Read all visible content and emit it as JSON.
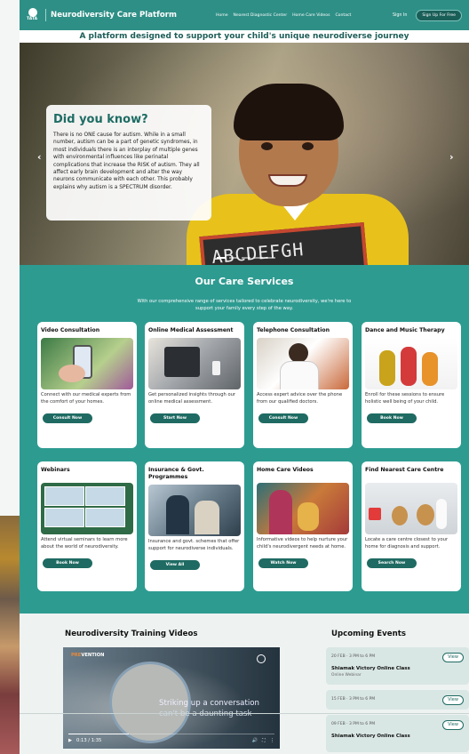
{
  "nav": {
    "logo_small": "TATA",
    "title": "Neurodiversity Care Platform",
    "links": [
      "Home",
      "Nearest Diagnostic Center",
      "Home Care Videos",
      "Contact"
    ],
    "sign_in": "Sign In",
    "sign_up": "Sign Up For Free"
  },
  "tagline": "A platform designed to support your child's unique neurodiverse journey",
  "hero": {
    "card_title": "Did you know?",
    "card_text": "There is no ONE cause for autism. While in a small number, autism can be a part of genetic syndromes, in most individuals there is an interplay of multiple genes with environmental influences like perinatal complications that increase the RISK of autism. They all affect early brain development and alter the way neurons communicate with each other. This probably explains why autism is a SPECTRUM disorder.",
    "slate_text": "ABCDEFGH",
    "prev_arrow": "‹",
    "next_arrow": "›"
  },
  "services": {
    "title": "Our Care Services",
    "intro": "With our comprehensive range of services tailored to celebrate neurodiversity, we're here to support your family every step of the way.",
    "cards": [
      {
        "title": "Video Consultation",
        "text": "Connect with our medical experts from the comfort of your homes.",
        "button": "Consult Now"
      },
      {
        "title": "Online Medical Assessment",
        "text": "Get personalized insights through our online medical assessment.",
        "button": "Start Now"
      },
      {
        "title": "Telephone Consultation",
        "text": "Access expert advice over the phone from our qualified doctors.",
        "button": "Consult Now"
      },
      {
        "title": "Dance and Music Therapy",
        "text": "Enroll for these sessions to ensure holistic well being of your child.",
        "button": "Book Now"
      },
      {
        "title": "Webinars",
        "text": "Attend virtual seminars to learn more about the world of neurodiversity.",
        "button": "Book Now"
      },
      {
        "title": "Insurance & Govt. Programmes",
        "text": "Insurance and govt. schemes that offer support for neurodiverse individuals.",
        "button": "View All"
      },
      {
        "title": "Home Care Videos",
        "text": "Informative videos to help nurture your child's neurodivergent needs at home.",
        "button": "Watch Now"
      },
      {
        "title": "Find Nearest Care Centre",
        "text": "Locate a care centre closest to your home for diagnosis and support.",
        "button": "Search Now"
      }
    ]
  },
  "training": {
    "title": "Neurodiversity Training Videos",
    "brand_pre": "PRE",
    "brand_post": "VENTION",
    "caption_line1": "Striking up a conversation",
    "caption_line2": "can't be a daunting task",
    "time": "0:13 / 1:35",
    "play": "▶",
    "volume": "🔊",
    "fullscreen": "⛶",
    "more": "⋮"
  },
  "events": {
    "title": "Upcoming Events",
    "items": [
      {
        "date": "20 FEB · 3 PM to 6 PM",
        "name": "Shiamak Victory Online Class",
        "sub": "Online Webinar",
        "view": "View"
      },
      {
        "date": "15 FEB · 3 PM to 6 PM",
        "name": "",
        "sub": "",
        "view": "View"
      },
      {
        "date": "09 FEB · 3 PM to 6 PM",
        "name": "Shiamak Victory Online Class",
        "sub": "",
        "view": "View"
      }
    ]
  }
}
